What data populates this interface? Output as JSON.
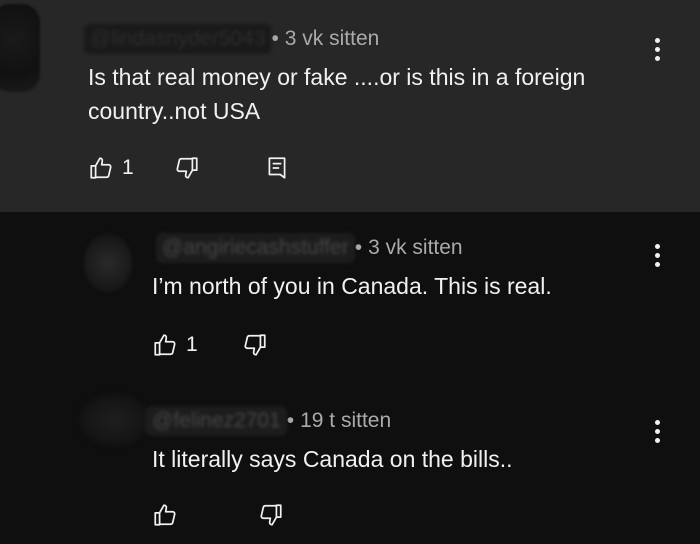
{
  "comments": [
    {
      "handle": "@lindasnyder5043",
      "separator": "•",
      "time": "3 vk sitten",
      "text": "Is that real money or fake ....or is this in a foreign country..not USA",
      "likes": "1",
      "icons": [
        "thumbs-up-icon",
        "thumbs-down-icon",
        "reply-icon",
        "more-vertical-icon"
      ]
    },
    {
      "handle": "@angiriecashstuffer",
      "separator": "•",
      "time": "3 vk sitten",
      "text": "I’m north of you in Canada. This is real.",
      "likes": "1",
      "icons": [
        "thumbs-up-icon",
        "thumbs-down-icon",
        "more-vertical-icon"
      ]
    },
    {
      "handle": "@felinez2701",
      "separator": "•",
      "time": "19 t sitten",
      "text": "It literally says Canada on the bills..",
      "likes": "",
      "icons": [
        "thumbs-up-icon",
        "thumbs-down-icon",
        "more-vertical-icon"
      ]
    }
  ],
  "colors": {
    "first_comment_bg": "#272727",
    "page_bg": "#0f0f0f",
    "text": "#f1f1f1",
    "meta": "#aaaaaa"
  }
}
